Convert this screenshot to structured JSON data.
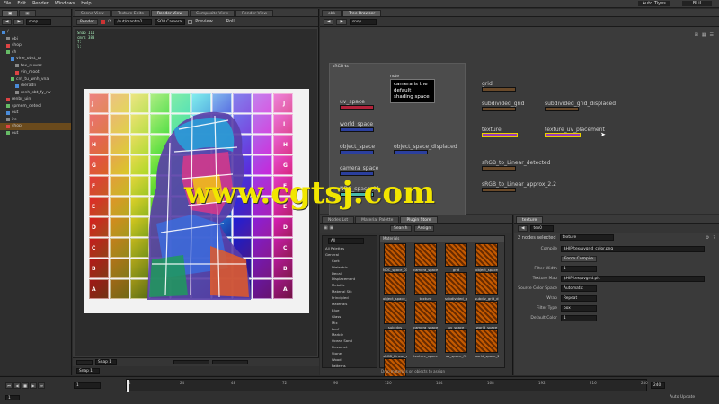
{
  "menu": {
    "items": [
      "File",
      "Edit",
      "Render",
      "Windows",
      "Help"
    ],
    "desktop_label": "Auto Tiyes",
    "right_label": "Bl il"
  },
  "left_pane": {
    "tree_title": "snop",
    "tree_rows": [
      {
        "label": "/",
        "indent": 0
      },
      {
        "label": "obj",
        "indent": 1
      },
      {
        "label": "shop",
        "indent": 1
      },
      {
        "label": "ch",
        "indent": 1
      },
      {
        "label": "vine_obst_ur",
        "indent": 2
      },
      {
        "label": "tex_nuwas",
        "indent": 3
      },
      {
        "label": "vin_moot",
        "indent": 3
      },
      {
        "label": "cnt_tu_wnh_vna",
        "indent": 2
      },
      {
        "label": "dieradli",
        "indent": 3
      },
      {
        "label": "renh_sbt_fy_nv",
        "indent": 3
      },
      {
        "label": "renbr_uin",
        "indent": 1
      },
      {
        "label": "spmem_detecl",
        "indent": 1
      },
      {
        "label": "out",
        "indent": 1
      },
      {
        "label": "ire",
        "indent": 1
      },
      {
        "label": "shop",
        "indent": 1,
        "selected": true
      },
      {
        "label": "out",
        "indent": 1
      }
    ]
  },
  "viewer": {
    "tabs": [
      "Scene View",
      "Texture Edits",
      "Render View",
      "Composite View",
      "Render View"
    ],
    "toolbar": {
      "renderer_btn": "Render",
      "camera_field": "/out/mantra1",
      "camera2": "SOP Camera",
      "preview": "Preview",
      "roll": "Roll"
    },
    "overlay_lines": [
      "Snap 111",
      "cmrs 380",
      "f:",
      "l:"
    ],
    "grid_letters": [
      "A",
      "B",
      "C",
      "D",
      "E",
      "F",
      "G",
      "H",
      "I",
      "J"
    ],
    "bottom_frame": "Snap 1"
  },
  "network": {
    "tabs": [
      "obk",
      "Tree Browser"
    ],
    "path": "snop",
    "box_label": "sRGB to",
    "sticky_note": {
      "title": "note",
      "text": "camera is the default shading space"
    },
    "nodes": [
      {
        "label": "uv_space",
        "color": "#b3223a"
      },
      {
        "label": "world_space",
        "color": "#2b3f9e"
      },
      {
        "label": "object_space",
        "color": "#2b3f9e"
      },
      {
        "label": "object_space_displaced",
        "color": "#2b3f9e"
      },
      {
        "label": "camera_space",
        "color": "#2b3f9e"
      },
      {
        "label": "NDC_space_01",
        "color": "#49b8a8"
      },
      {
        "label": "grid",
        "color": "#6a4a2a"
      },
      {
        "label": "subdivided_grid",
        "color": "#6a4a2a"
      },
      {
        "label": "subdivided_grid_displaced",
        "color": "#6a4a2a"
      },
      {
        "label": "texture",
        "color": "#9a3ab5"
      },
      {
        "label": "texture_uv_placement",
        "color": "#9a3ab5"
      },
      {
        "label": "sRGB_to_Linear_detected",
        "color": "#6a4a2a"
      },
      {
        "label": "sRGB_to_Linear_approx_2.2",
        "color": "#6a4a2a"
      }
    ]
  },
  "material_palette": {
    "tabs": [
      "Nodes Lst",
      "Material Palette",
      "Plugin Store"
    ],
    "search_btn": "Search",
    "assign_btn": "Assign",
    "header": "All",
    "section_title": "Materials",
    "categories": [
      "All Palettes",
      "General",
      "Cork",
      "Dielectric",
      "Decal",
      "Displacement",
      "Metallic",
      "Material Stk",
      "Principled",
      "Materials",
      "Blue",
      "Glass",
      "Mix",
      "Leaf",
      "Marble",
      "Ocean Sand",
      "Piezomet",
      "Stone",
      "Wood",
      "Patterns"
    ],
    "swatches": [
      "NDC_space_01",
      "camera_space",
      "grid",
      "object_space",
      "object_space_d",
      "texture",
      "subdivided_g",
      "subdiv_grid_d",
      "sub_dvs",
      "camera_space",
      "uv_space",
      "world_space",
      "sRGB_Linear_a",
      "texture_space",
      "uv_space_flt",
      "world_space_2",
      "world_space"
    ],
    "footer": "Drop materials on objects to assign"
  },
  "properties": {
    "tabs": [
      "texture"
    ],
    "node_name": "tex0",
    "node_type": "texture",
    "summary": "2 nodes selected",
    "rows": [
      {
        "label": "Compile",
        "value": "$HIP/tex/uvgrid_color.png"
      },
      {
        "label": "",
        "value": "Force Compile"
      },
      {
        "label": "Filter Width",
        "value": "1"
      },
      {
        "label": "Texture Map",
        "value": "$HIP/tex/uvgrid.pic"
      },
      {
        "label": "Source Color Space",
        "value": "Automatic"
      },
      {
        "label": "Wrap",
        "value": "Repeat"
      },
      {
        "label": "Filter Type",
        "value": "box"
      },
      {
        "label": "Default Color",
        "value": "1"
      }
    ]
  },
  "timeline": {
    "start_frame": "1",
    "end_frame": "240",
    "current_frame": "1",
    "ticks": [
      "1",
      "24",
      "48",
      "72",
      "96",
      "120",
      "144",
      "168",
      "192",
      "216",
      "240"
    ],
    "right_label": "Auto Update",
    "right_field": "Outer Auto"
  },
  "watermark": "www.cgtsj.com"
}
